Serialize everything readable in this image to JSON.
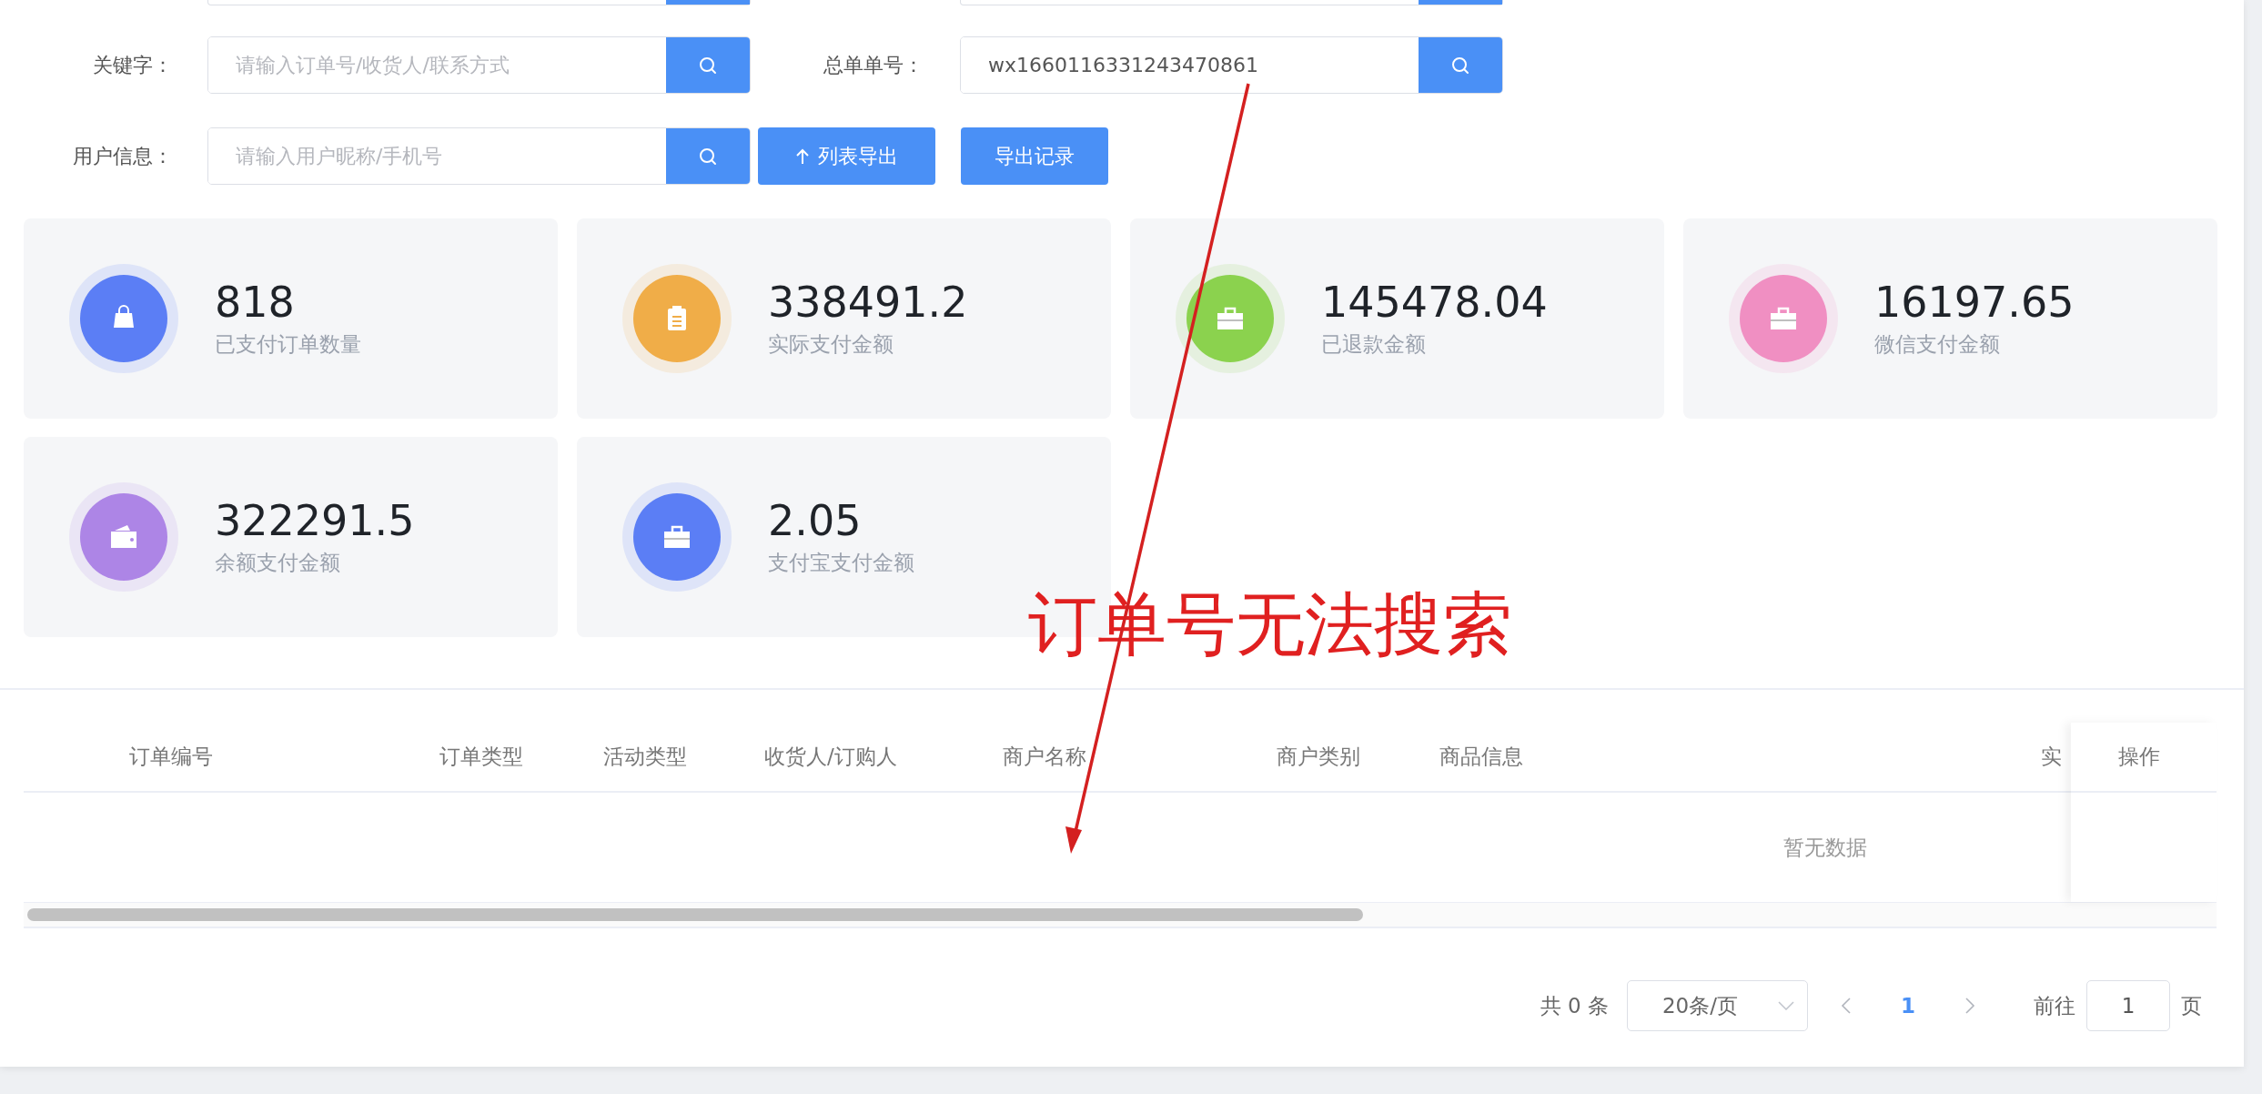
{
  "filters": [
    {
      "label": "关键字：",
      "placeholder": "请输入订单号/收货人/联系方式"
    },
    {
      "label": "总单单号：",
      "value": "wx1660116331243470861"
    },
    {
      "label": "用户信息：",
      "placeholder": "请输入用户昵称/手机号"
    }
  ],
  "actions": [
    {
      "label": "列表导出",
      "kind": "export"
    },
    {
      "label": "导出记录",
      "kind": "plain"
    }
  ],
  "stats": [
    {
      "value": "818",
      "label": "已支付订单数量",
      "color": "#5b7ef5",
      "kind": "bag"
    },
    {
      "value": "338491.2",
      "label": "实际支付金额",
      "color": "#f0ad48",
      "kind": "clipboard"
    },
    {
      "value": "145478.04",
      "label": "已退款金额",
      "color": "#8bd24e",
      "kind": "briefcase"
    },
    {
      "value": "16197.65",
      "label": "微信支付金额",
      "color": "#f08fc2",
      "kind": "briefcase"
    },
    {
      "value": "322291.5",
      "label": "余额支付金额",
      "color": "#ad85e6",
      "kind": "wallet"
    },
    {
      "value": "2.05",
      "label": "支付宝支付金额",
      "color": "#5b7ef5",
      "kind": "briefcase"
    }
  ],
  "table": {
    "columns": [
      "订单编号",
      "订单类型",
      "活动类型",
      "收货人/订购人",
      "商户名称",
      "商户类别",
      "商品信息",
      "实"
    ],
    "fixed_column": "操作",
    "empty_text": "暂无数据"
  },
  "pagination": {
    "total": "共 0 条",
    "page_size": "20条/页",
    "pages": [
      {
        "label": "1",
        "selected": true
      }
    ],
    "goto_label": "前往",
    "goto_value": "1",
    "goto_unit": "页"
  },
  "annotation": {
    "text": "订单号无法搜索"
  }
}
